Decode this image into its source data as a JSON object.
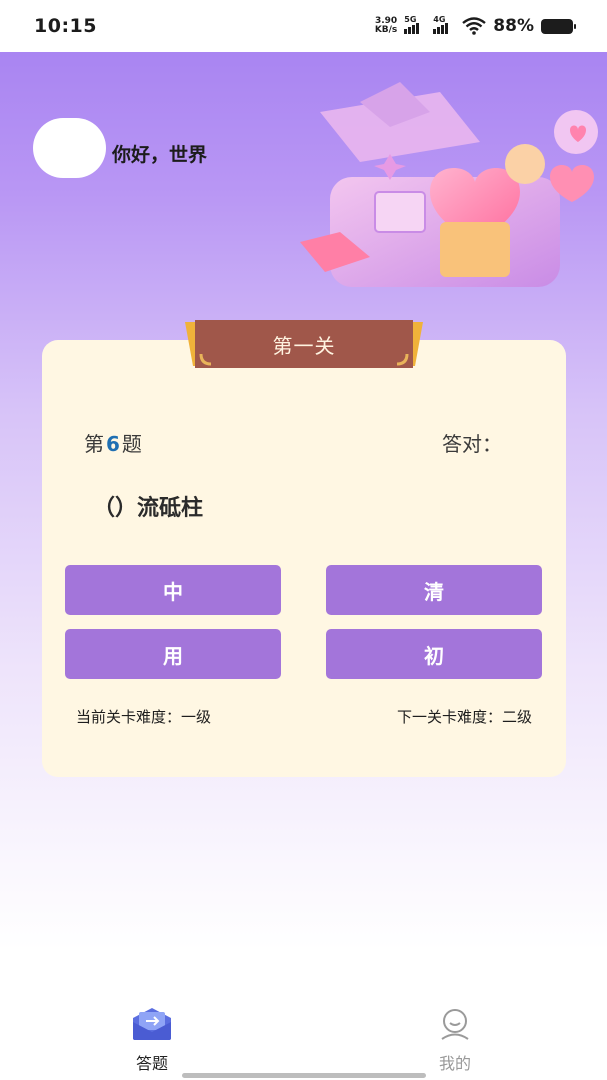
{
  "status_bar": {
    "time": "10:15",
    "net_speed_value": "3.90",
    "net_speed_unit": "KB/s",
    "sig1_label": "5G",
    "sig2_label": "4G",
    "battery": "88%"
  },
  "header": {
    "greeting": "你好，世界"
  },
  "level": {
    "banner": "第一关",
    "question_prefix": "第",
    "question_number": "6",
    "question_suffix": "题",
    "correct_label": "答对：",
    "question_text": "（）流砥柱",
    "options": [
      "中",
      "清",
      "用",
      "初"
    ],
    "current_difficulty": "当前关卡难度：一级",
    "next_difficulty": "下一关卡难度：二级"
  },
  "nav": {
    "tabs": [
      {
        "label": "答题",
        "icon": "quiz-icon",
        "active": true
      },
      {
        "label": "我的",
        "icon": "profile-icon",
        "active": false
      }
    ]
  },
  "colors": {
    "accent": "#a375da",
    "card": "#fff7e3",
    "banner": "#a0574a"
  }
}
